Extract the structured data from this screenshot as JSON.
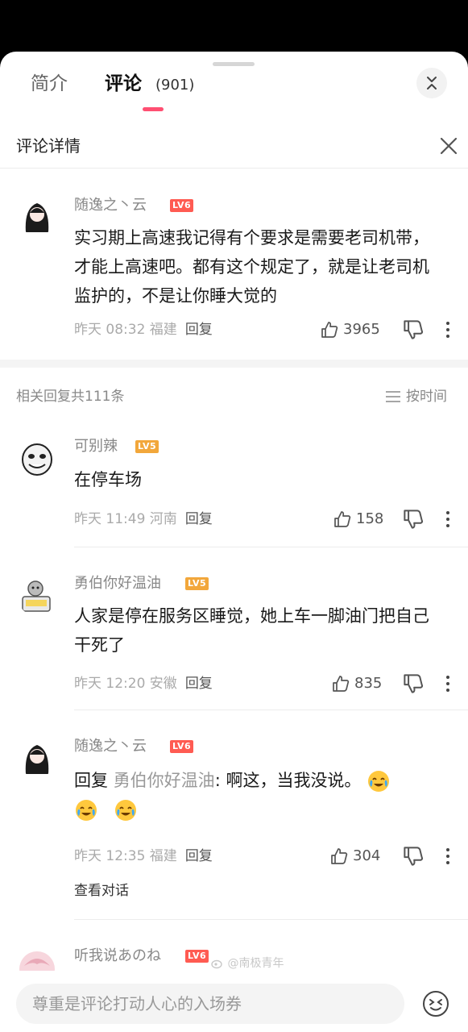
{
  "tabs": {
    "intro": "简介",
    "comments": "评论",
    "count": "(901)"
  },
  "detail": {
    "title": "评论详情"
  },
  "root_comment": {
    "username": "随逸之丶云",
    "level": "LV6",
    "text": "实习期上高速我记得有个要求是需要老司机带，才能上高速吧。都有这个规定了，就是让老司机监护的，不是让你睡大觉的",
    "time": "昨天 08:32 福建",
    "reply": "回复",
    "likes": "3965"
  },
  "replies_header": {
    "count_label": "相关回复共111条",
    "sort_label": "按时间"
  },
  "replies": [
    {
      "username": "可别辣",
      "level": "LV5",
      "text": "在停车场",
      "time": "昨天 11:49 河南",
      "reply": "回复",
      "likes": "158"
    },
    {
      "username": "勇伯你好温油",
      "level": "LV5",
      "text": "人家是停在服务区睡觉，她上车一脚油门把自己干死了",
      "time": "昨天 12:20 安徽",
      "reply": "回复",
      "likes": "835"
    },
    {
      "username": "随逸之丶云",
      "level": "LV6",
      "reply_prefix": "回复",
      "mention": "勇伯你好温油",
      "text": ": 啊这，当我没说。",
      "time": "昨天 12:35 福建",
      "reply": "回复",
      "likes": "304",
      "view_conversation": "查看对话"
    },
    {
      "username": "听我说あのね",
      "level": "LV6"
    }
  ],
  "input": {
    "placeholder": "尊重是评论打动人心的入场券"
  },
  "watermark": "@南极青年",
  "icons": [
    "collapse-icon",
    "close-icon",
    "thumbs-up-icon",
    "thumbs-down-icon",
    "more-icon",
    "sort-icon",
    "emoji-icon",
    "crying-laughing-emoji",
    "weibo-logo"
  ],
  "colors": {
    "accent": "#ff4f72",
    "lv6": "#ff5b52",
    "lv5": "#f2a73b"
  }
}
